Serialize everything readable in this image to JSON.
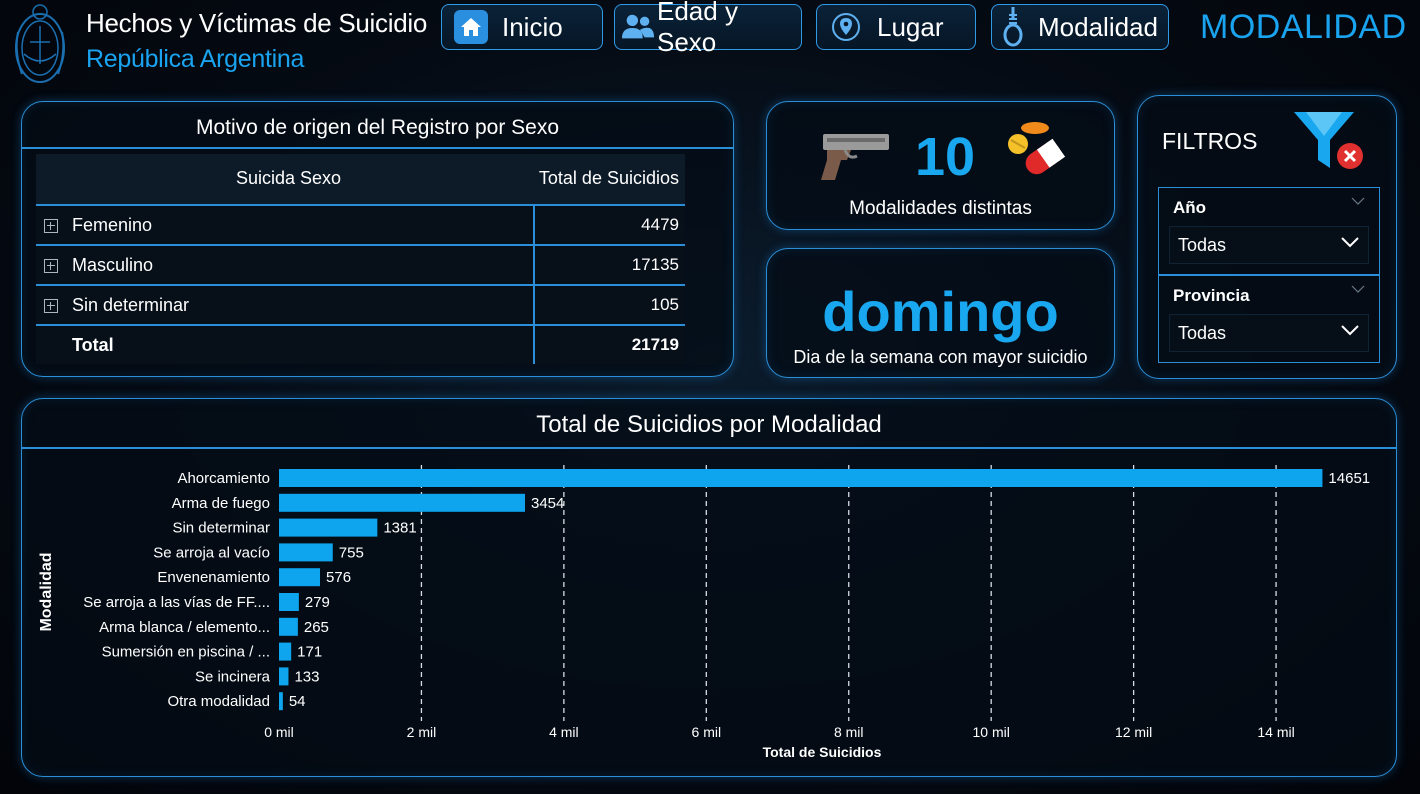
{
  "header": {
    "title": "Hechos y Víctimas de Suicidio",
    "subtitle": "República Argentina",
    "page_title": "MODALIDAD",
    "nav": [
      {
        "label": "Inicio",
        "icon": "home-icon"
      },
      {
        "label": "Edad y Sexo",
        "icon": "users-icon"
      },
      {
        "label": "Lugar",
        "icon": "location-pin-icon"
      },
      {
        "label": "Modalidad",
        "icon": "noose-icon"
      }
    ]
  },
  "sex_table": {
    "title": "Motivo de origen del Registro por Sexo",
    "col_sex": "Suicida Sexo",
    "col_total": "Total de Suicidios",
    "rows": [
      {
        "label": "Femenino",
        "value": "4479"
      },
      {
        "label": "Masculino",
        "value": "17135"
      },
      {
        "label": "Sin determinar",
        "value": "105"
      }
    ],
    "total_label": "Total",
    "total_value": "21719"
  },
  "kpi_modalidades": {
    "value": "10",
    "label": "Modalidades distintas"
  },
  "kpi_dia": {
    "value": "domingo",
    "label": "Dia de la semana con mayor suicidio"
  },
  "filters": {
    "title": "FILTROS",
    "year": {
      "label": "Año",
      "value": "Todas"
    },
    "province": {
      "label": "Provincia",
      "value": "Todas"
    }
  },
  "colors": {
    "accent": "#19a7f0",
    "bar": "#0ea5ee",
    "border": "#2a8fd8"
  },
  "chart_data": {
    "type": "bar",
    "orientation": "horizontal",
    "title": "Total de Suicidios por Modalidad",
    "xlabel": "Total de Suicidios",
    "ylabel": "Modalidad",
    "categories": [
      "Ahorcamiento",
      "Arma de fuego",
      "Sin determinar",
      "Se arroja al vacío",
      "Envenenamiento",
      "Se arroja a las vías de FF....",
      "Arma blanca / elemento...",
      "Sumersión en piscina / ...",
      "Se incinera",
      "Otra modalidad"
    ],
    "values": [
      14651,
      3454,
      1381,
      755,
      576,
      279,
      265,
      171,
      133,
      54
    ],
    "xlim": [
      0,
      15000
    ],
    "xticks": [
      0,
      2000,
      4000,
      6000,
      8000,
      10000,
      12000,
      14000
    ],
    "xtick_labels": [
      "0 mil",
      "2 mil",
      "4 mil",
      "6 mil",
      "8 mil",
      "10 mil",
      "12 mil",
      "14 mil"
    ],
    "grid": "vertical dashed"
  }
}
